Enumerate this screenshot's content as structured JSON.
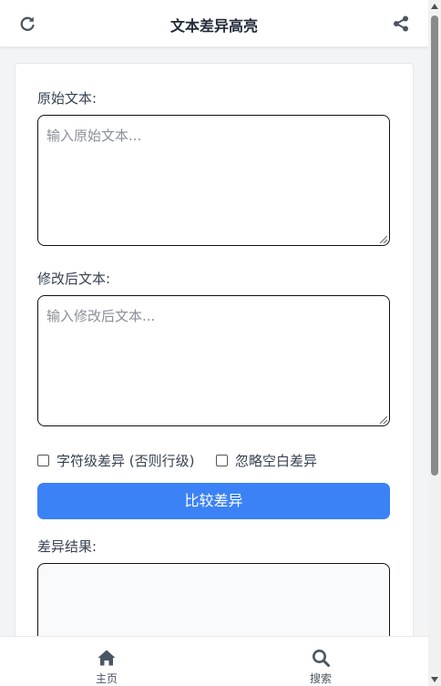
{
  "header": {
    "title": "文本差异高亮",
    "left_icon": "refresh-icon",
    "right_icon": "share-icon"
  },
  "form": {
    "original_label": "原始文本:",
    "original_placeholder": "输入原始文本...",
    "modified_label": "修改后文本:",
    "modified_placeholder": "输入修改后文本...",
    "char_level_label": "字符级差异 (否则行级)",
    "ignore_whitespace_label": "忽略空白差异",
    "compare_button": "比较差异",
    "result_label": "差异结果:"
  },
  "bottom_nav": {
    "items": [
      {
        "label": "主页",
        "icon": "home-icon"
      },
      {
        "label": "搜索",
        "icon": "search-icon"
      }
    ]
  },
  "colors": {
    "accent": "#3b82f6",
    "text": "#374151",
    "nav_icon": "#4b5563"
  }
}
